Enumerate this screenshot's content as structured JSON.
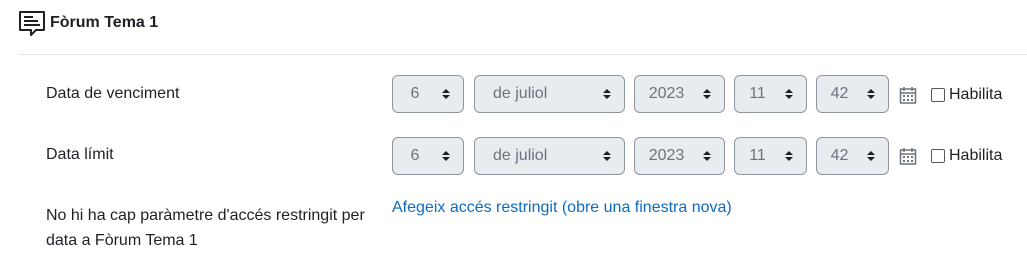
{
  "header": {
    "title": "Fòrum Tema 1",
    "icon": "forum-icon"
  },
  "due_date": {
    "label": "Data de venciment",
    "day": "6",
    "month": "de juliol",
    "year": "2023",
    "hour": "11",
    "minute": "42",
    "enable_label": "Habilita",
    "enabled": false
  },
  "cutoff_date": {
    "label": "Data límit",
    "day": "6",
    "month": "de juliol",
    "year": "2023",
    "hour": "11",
    "minute": "42",
    "enable_label": "Habilita",
    "enabled": false
  },
  "restrict": {
    "text": "No hi ha cap paràmetre d'accés restringit per data a Fòrum Tema 1",
    "link": "Afegeix accés restringit (obre una finestra nova)"
  },
  "colors": {
    "link": "#0f6cbf",
    "disabled_bg": "#e9ecef",
    "text": "#1d2125"
  }
}
